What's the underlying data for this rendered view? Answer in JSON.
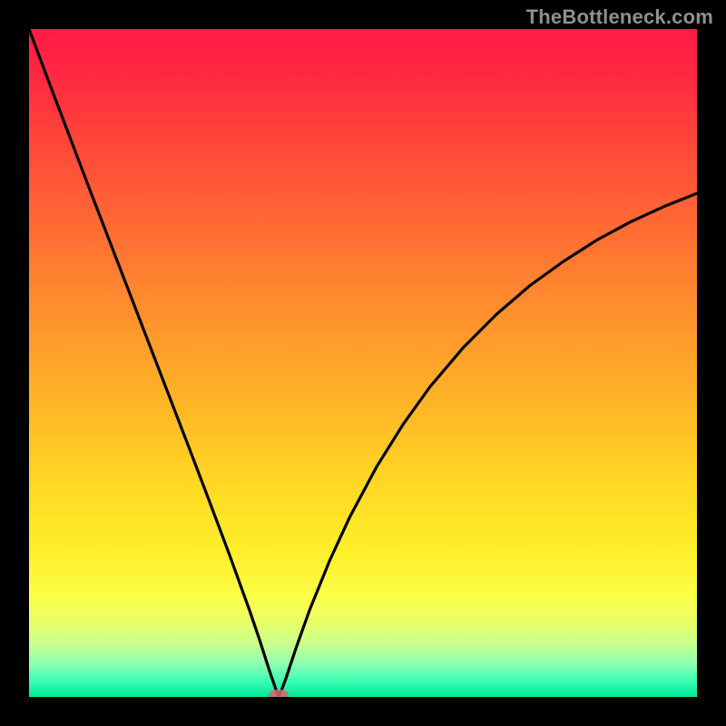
{
  "watermark": "TheBottleneck.com",
  "palette": {
    "frame": "#000000",
    "curve": "#000000",
    "marker": "#d26a6a",
    "gradient_top": "#ff1a47",
    "gradient_bottom": "#00e89a"
  },
  "chart_data": {
    "type": "line",
    "title": "",
    "xlabel": "",
    "ylabel": "",
    "xlim": [
      0,
      100
    ],
    "ylim": [
      0,
      100
    ],
    "series": [
      {
        "name": "bottleneck-curve",
        "x": [
          0,
          3,
          6,
          9,
          12,
          15,
          18,
          21,
          24,
          27,
          30,
          33,
          34.5,
          36,
          37,
          37.4,
          37.8,
          38.5,
          40,
          42,
          45,
          48,
          52,
          56,
          60,
          65,
          70,
          75,
          80,
          85,
          90,
          95,
          100
        ],
        "y": [
          100,
          92.0,
          84.1,
          76.2,
          68.4,
          60.6,
          52.8,
          45.0,
          37.2,
          29.3,
          21.3,
          13.0,
          8.6,
          3.9,
          1.0,
          0.2,
          1.0,
          2.9,
          7.4,
          13.0,
          20.4,
          26.9,
          34.4,
          40.8,
          46.4,
          52.3,
          57.3,
          61.6,
          65.2,
          68.4,
          71.1,
          73.4,
          75.4
        ]
      }
    ],
    "marker": {
      "x": 37.4,
      "y": 0.2
    },
    "grid": false,
    "legend": "none"
  }
}
